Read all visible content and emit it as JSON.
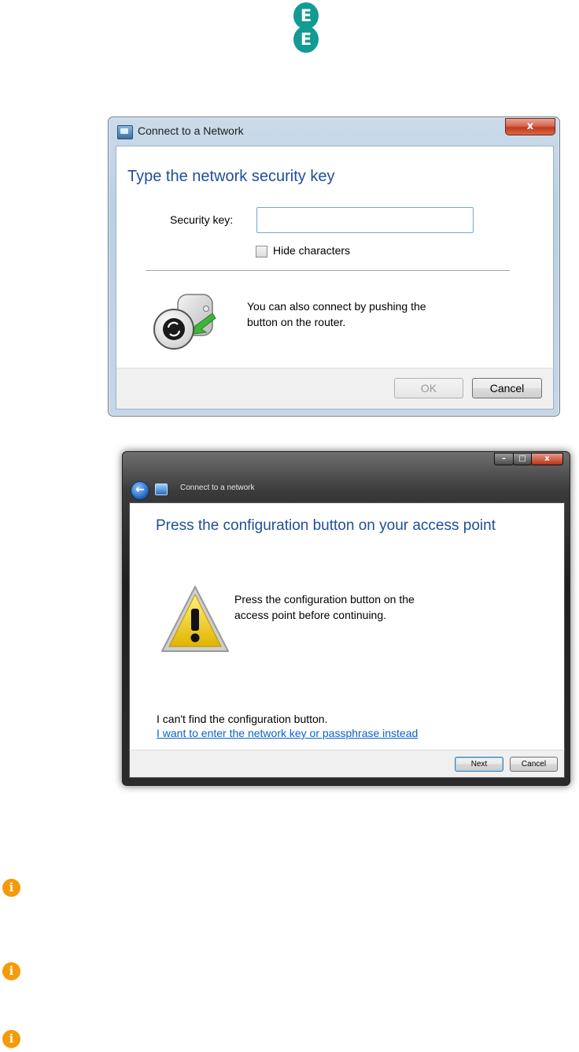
{
  "logo": {
    "letter_top": "E",
    "letter_bottom": "E"
  },
  "dialog_win7": {
    "title": "Connect to a Network",
    "close_glyph": "x",
    "heading": "Type the network security key",
    "security_key_label": "Security key:",
    "security_key_value": "",
    "hide_characters_label": "Hide characters",
    "hide_characters_checked": false,
    "wps_text_line1": "You can also connect by pushing the",
    "wps_text_line2": "button on the router.",
    "ok_label": "OK",
    "ok_enabled": false,
    "cancel_label": "Cancel"
  },
  "dialog_vista": {
    "min_glyph": "–",
    "max_glyph": "□",
    "close_glyph": "x",
    "breadcrumb": "Connect to a network",
    "heading": "Press the configuration button on your access point",
    "message_line1": "Press the configuration button on the",
    "message_line2": "access point before continuing.",
    "cant_find": "I can't find the configuration button.",
    "link": "I want to enter the network key or passphrase instead",
    "next_label": "Next",
    "cancel_label": "Cancel"
  },
  "info_icons": [
    "info-icon",
    "info-icon",
    "info-icon"
  ],
  "info_glyph": "i",
  "colors": {
    "ee_teal": "#139a92",
    "heading_blue": "#1e4f9c",
    "link_blue": "#0b62c7",
    "info_orange": "#f59a08"
  }
}
